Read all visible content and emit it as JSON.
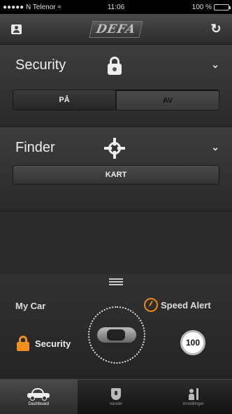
{
  "status_bar": {
    "carrier": "●●●●● N Telenor ≈",
    "time": "11:06",
    "battery": "100 %"
  },
  "nav": {
    "logo": "DEFA",
    "left_icon": "contact-card-icon",
    "right_icon": "refresh-icon"
  },
  "security_panel": {
    "title": "Security",
    "icon": "lock-icon",
    "options": [
      "PÅ",
      "AV"
    ],
    "selected": "AV"
  },
  "finder_panel": {
    "title": "Finder",
    "icon": "crosshair-icon",
    "map_button": "KART"
  },
  "dashboard": {
    "my_car_label": "My Car",
    "speed_alert_label": "Speed Alert",
    "security_label": "Security",
    "speed_limit": "100"
  },
  "tabs": [
    {
      "label": "Dashboard",
      "icon": "car-icon"
    },
    {
      "label": "Varsler",
      "icon": "shield-icon"
    },
    {
      "label": "Innstillinger",
      "icon": "settings-icon"
    }
  ],
  "colors": {
    "accent_orange": "#f0901e",
    "battery_green": "#5bd45b"
  }
}
